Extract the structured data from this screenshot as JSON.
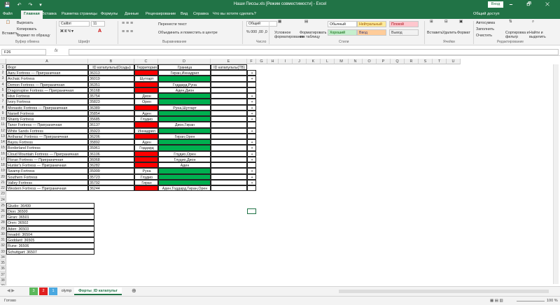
{
  "window": {
    "title": "Наши Писсы.xls [Режим совместимости] - Excel",
    "signin_label": "Вход",
    "quick_access": "💾 ↶ ↷ ▾",
    "controls": "🗕 🗗 ✕"
  },
  "tabs": [
    "Файл",
    "Главная",
    "Вставка",
    "Разметка страницы",
    "Формулы",
    "Данные",
    "Рецензирование",
    "Вид",
    "Справка",
    "Что вы хотите сделать?"
  ],
  "tab_share": "Общий доступ",
  "ribbon": {
    "paste": "Вставить",
    "cut": "Вырезать",
    "copy": "Копировать",
    "format_painter": "Формат по образцу",
    "group_clipboard": "Буфер обмена",
    "font_name": "Calibri",
    "font_size": "11",
    "font_buttons": "Ж К Ч ▾",
    "group_font": "Шрифт",
    "wrap_text": "Перенести текст",
    "merge_center": "Объединить и поместить в центре",
    "group_alignment": "Выравнивание",
    "number_format": "Общий",
    "number_buttons": "% 000 ,00 ,0",
    "group_number": "Число",
    "cond_format": "Условное форматирование",
    "format_table": "Форматировать как таблицу",
    "styles": [
      {
        "label": "Обычный",
        "bg": "#ffffff",
        "fg": "#222222"
      },
      {
        "label": "Нейтральный",
        "bg": "#ffeb9c",
        "fg": "#9c5700"
      },
      {
        "label": "Плохой",
        "bg": "#ffc7ce",
        "fg": "#9c0006"
      },
      {
        "label": "Хороший",
        "bg": "#c6efce",
        "fg": "#006100"
      },
      {
        "label": "Ввод",
        "bg": "#ffcc99",
        "fg": "#3f3f76"
      },
      {
        "label": "Вывод",
        "bg": "#f2f2f2",
        "fg": "#3f3f3f"
      }
    ],
    "group_styles": "Стили",
    "insert": "Вставить",
    "delete": "Удалить",
    "format": "Формат",
    "group_cells": "Ячейки",
    "autosum": "Автосумма",
    "fill": "Заполнить",
    "clear": "Очистить",
    "sort_filter": "Сортировка и фильтр",
    "find_select": "Найти и выделить",
    "group_editing": "Редактирование"
  },
  "formula_bar": {
    "name_box": "F26",
    "fx": "fx",
    "value": ""
  },
  "columns": [
    "A",
    "B",
    "C",
    "D",
    "E",
    "F",
    "G",
    "H",
    "I",
    "J",
    "K",
    "L",
    "M",
    "N",
    "O",
    "P",
    "Q",
    "R",
    "S",
    "T",
    "U"
  ],
  "colors": {
    "red": "#ff0000",
    "green": "#00b050",
    "accent": "#217346",
    "selection": "#217346"
  },
  "table": {
    "headers": [
      "Форт",
      "ID катапульты(Осады)",
      "Территория",
      "Граница",
      "ID катапульты(ТВ)"
    ],
    "rows": [
      {
        "fort": "Aaru Fortress — Приграничная",
        "id": "36313",
        "terr": "",
        "tc": "red",
        "border": "Гиран,Иннадрил",
        "bc": "",
        "e": "+"
      },
      {
        "fort": "Archaic Fortress",
        "id": "36019",
        "terr": "Шутгарт",
        "tc": "",
        "border": "",
        "bc": "green",
        "e": "+"
      },
      {
        "fort": "Demon Fortress — Приграничная",
        "id": "36351",
        "terr": "",
        "tc": "red",
        "border": "Годдард,Руна",
        "bc": "",
        "e": ""
      },
      {
        "fort": "Dragonspine Fortress — Приграничная",
        "id": "36168",
        "terr": "",
        "tc": "red",
        "border": "Аден,Дион",
        "bc": "",
        "e": ""
      },
      {
        "fort": "Hive Fortress",
        "id": "35754",
        "terr": "Дион",
        "tc": "",
        "border": "",
        "bc": "green",
        "e": "+"
      },
      {
        "fort": "Ivory Fortress",
        "id": "35823",
        "terr": "Орен",
        "tc": "",
        "border": "",
        "bc": "green",
        "e": "+"
      },
      {
        "fort": "Monastic Fortress — Приграничная",
        "id": "36389",
        "terr": "",
        "tc": "red",
        "border": "Руна,Шутгарт",
        "bc": "",
        "e": "+"
      },
      {
        "fort": "Narsell Fortress",
        "id": "35854",
        "terr": "Аден",
        "tc": "",
        "border": "",
        "bc": "green",
        "e": "+"
      },
      {
        "fort": "Shanty Fortress",
        "id": "35685",
        "terr": "Глудио",
        "tc": "",
        "border": "",
        "bc": "green",
        "e": "+"
      },
      {
        "fort": "Tanor Fortress — Приграничная",
        "id": "36137",
        "terr": "",
        "tc": "red",
        "border": "Дион,Гиран",
        "bc": "",
        "e": ""
      },
      {
        "fort": "White Sands Fortress",
        "id": "35923",
        "terr": "Иннадрил",
        "tc": "",
        "border": "",
        "bc": "green",
        "e": "+"
      },
      {
        "fort": "Antharas' Fortress — Приграничная",
        "id": "36206",
        "terr": "",
        "tc": "red",
        "border": "Гиран,Орен",
        "bc": "",
        "e": ""
      },
      {
        "fort": "Bayou Fortress",
        "id": "35892",
        "terr": "Аден",
        "tc": "",
        "border": "",
        "bc": "green",
        "e": "+"
      },
      {
        "fort": "Borderland Fortress",
        "id": "35961",
        "terr": "Годдард",
        "tc": "",
        "border": "",
        "bc": "green",
        "e": "+"
      },
      {
        "fort": "Cloud Mountain Fortress — Приграничная",
        "id": "36106",
        "terr": "",
        "tc": "red",
        "border": "Глудио,Орен",
        "bc": "",
        "e": "+"
      },
      {
        "fort": "Floran Fortress — Приграничная",
        "id": "36068",
        "terr": "",
        "tc": "red",
        "border": "Глудио,Дион",
        "bc": "",
        "e": "+"
      },
      {
        "fort": "Hunter's Fortress — Приграничная",
        "id": "36282",
        "terr": "",
        "tc": "red",
        "border": "Аден",
        "bc": "",
        "e": ""
      },
      {
        "fort": "Swamp Fortress",
        "id": "35999",
        "terr": "Руна",
        "tc": "",
        "border": "",
        "bc": "green",
        "e": "+"
      },
      {
        "fort": "Southern Fortress",
        "id": "35723",
        "terr": "Глудио",
        "tc": "",
        "border": "",
        "bc": "green",
        "e": "+"
      },
      {
        "fort": "Valley Fortress",
        "id": "35792",
        "terr": "Гиран",
        "tc": "",
        "border": "",
        "bc": "green",
        "e": "+"
      },
      {
        "fort": "Western Fortress — Приграничная",
        "id": "36244",
        "terr": "",
        "tc": "red",
        "border": "Аден,Годдард,Гиран,Орен",
        "bc": "",
        "e": ""
      }
    ]
  },
  "castles": [
    "Gludio: 36499",
    "Dion: 36500",
    "Giran: 36501",
    "Oren: 36502",
    "Aden: 36503",
    "Innadril: 36504",
    "Goddard: 36505",
    "Rune: 36506",
    "Schuttgart: 36507"
  ],
  "sheets": [
    {
      "label": "3",
      "bg": "#5cb85c",
      "fg": "#ffffff"
    },
    {
      "label": "2",
      "bg": "#e02020",
      "fg": "#ffffff"
    },
    {
      "label": "1",
      "bg": "#4aa8e0",
      "fg": "#ffffff"
    },
    {
      "label": "olymp",
      "bg": "#f3f3f3",
      "fg": "#333333"
    },
    {
      "label": "Форты_ID катапульт",
      "bg": "#ffffff",
      "fg": "#217346"
    }
  ],
  "status": {
    "ready": "Готово",
    "zoom": "100 %",
    "nav": "◀ ▶",
    "view_icons": "▦ ▤ ▥"
  }
}
